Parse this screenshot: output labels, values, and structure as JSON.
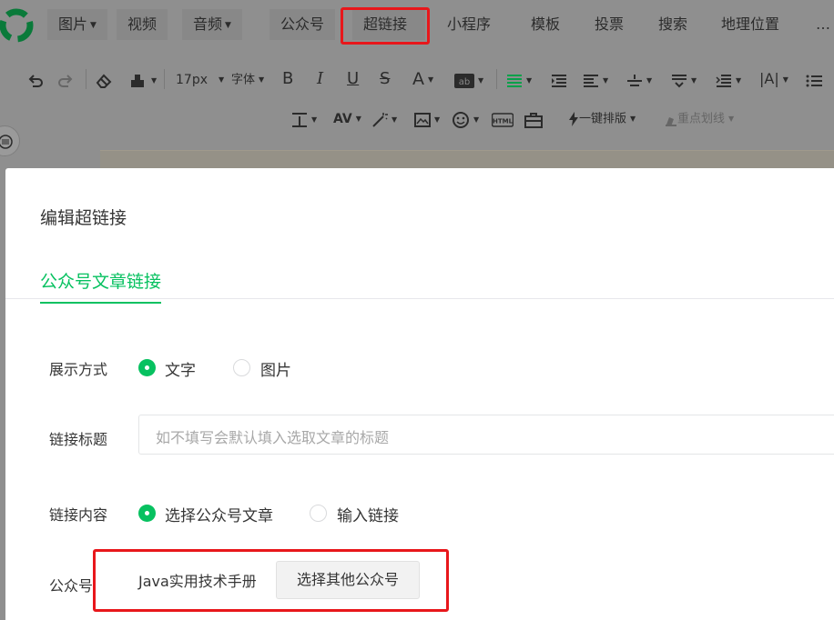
{
  "menu": {
    "items": [
      {
        "label": "图片",
        "dropdown": true
      },
      {
        "label": "视频",
        "dropdown": false
      },
      {
        "label": "音频",
        "dropdown": true
      },
      {
        "label": "公众号",
        "dropdown": false
      },
      {
        "label": "超链接",
        "dropdown": false,
        "highlighted": true
      },
      {
        "label": "小程序",
        "dropdown": false
      },
      {
        "label": "模板",
        "dropdown": false
      },
      {
        "label": "投票",
        "dropdown": false
      },
      {
        "label": "搜索",
        "dropdown": false
      },
      {
        "label": "地理位置",
        "dropdown": false
      }
    ],
    "more": "…"
  },
  "toolbar": {
    "font_size": "17px",
    "font_family": "字体",
    "one_click_layout": "一键排版",
    "highlight_underline": "重点划线",
    "icons": [
      "undo-icon",
      "redo-icon",
      "eraser-icon",
      "format-painter-icon",
      "bold-icon",
      "italic-icon",
      "underline-icon",
      "strikethrough-icon",
      "font-color-icon",
      "background-color-icon",
      "align-icon",
      "indent-icon",
      "line-height-icon",
      "paragraph-spacing-icon",
      "letter-spacing-icon",
      "list-icon",
      "image-icon",
      "emoji-icon",
      "html-icon",
      "toolbox-icon",
      "lightning-icon",
      "marker-icon"
    ]
  },
  "dialog": {
    "title": "编辑超链接",
    "tab": "公众号文章链接",
    "display_mode": {
      "label": "展示方式",
      "options": [
        {
          "label": "文字",
          "selected": true
        },
        {
          "label": "图片",
          "selected": false
        }
      ]
    },
    "link_title": {
      "label": "链接标题",
      "placeholder": "如不填写会默认填入选取文章的标题"
    },
    "link_content": {
      "label": "链接内容",
      "options": [
        {
          "label": "选择公众号文章",
          "selected": true
        },
        {
          "label": "输入链接",
          "selected": false
        }
      ]
    },
    "account": {
      "label": "公众号",
      "name": "Java实用技术手册",
      "button": "选择其他公众号"
    }
  },
  "colors": {
    "accent": "#07c160",
    "highlight_box": "#e8171b",
    "overlay": "#8f8f8f"
  }
}
